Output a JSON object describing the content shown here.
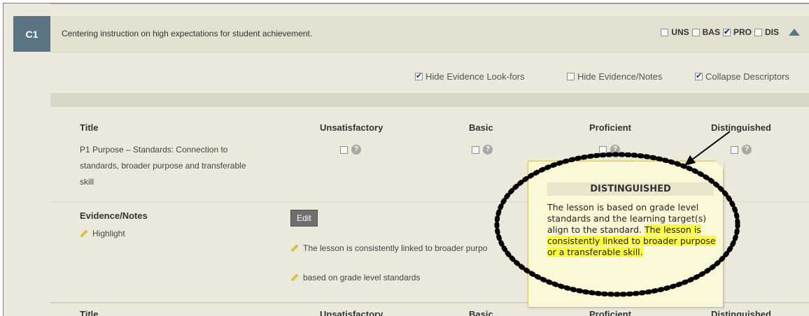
{
  "section": {
    "code": "C1",
    "title": "Centering instruction on high expectations for student achievement.",
    "levels": [
      {
        "label": "UNS",
        "checked": false
      },
      {
        "label": "BAS",
        "checked": false
      },
      {
        "label": "PRO",
        "checked": true
      },
      {
        "label": "DIS",
        "checked": false
      }
    ]
  },
  "options": {
    "hide_lookfors": "Hide Evidence Look-fors",
    "hide_evidence": "Hide Evidence/Notes",
    "collapse": "Collapse Descriptors"
  },
  "table": {
    "headers": [
      "Title",
      "Unsatisfactory",
      "Basic",
      "Proficient",
      "Distinguished"
    ],
    "row_title": "P1 Purpose – Standards: Connection to standards, broader purpose and transferable skill",
    "evidence_label": "Evidence/Notes",
    "highlight_label": "Highlight",
    "edit_label": "Edit",
    "notes": [
      "The lesson is consistently linked to broader purpo",
      "based on grade level standards"
    ],
    "help_glyph": "?"
  },
  "tooltip": {
    "heading": "DISTINGUISHED",
    "body_plain": "The lesson is based on grade level standards and the learning target(s) align to the standard.",
    "body_highlight": "The lesson is consistently linked to broader purpose or a transferable skill."
  },
  "icons": [
    "checkbox-icon",
    "help-icon",
    "pencil-icon",
    "collapse-arrow-icon",
    "annotation-arrow-icon"
  ],
  "colors": {
    "tab": "#5b7484",
    "highlight": "#ffff3b",
    "background": "#eae9dc",
    "tooltip": "#fbf8d7"
  }
}
